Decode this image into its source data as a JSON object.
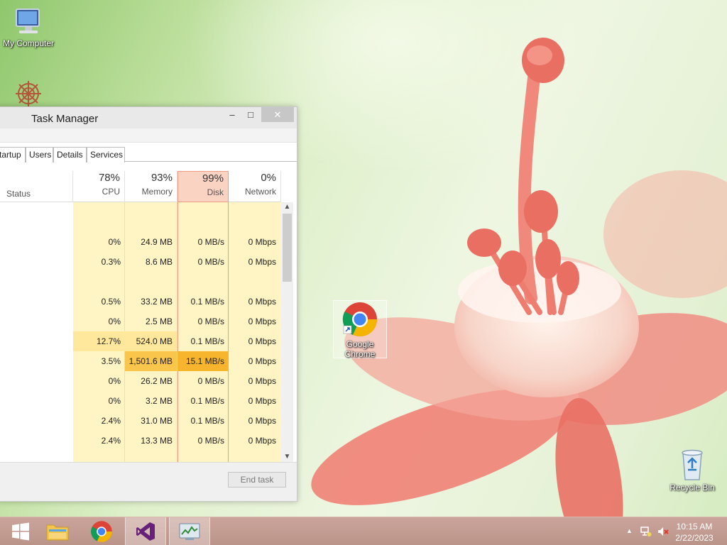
{
  "desktop": {
    "icons": [
      {
        "id": "my-computer",
        "label": "My Computer"
      },
      {
        "id": "google-chrome",
        "label": "Google Chrome"
      },
      {
        "id": "recycle-bin",
        "label": "Recycle Bin"
      }
    ]
  },
  "task_manager": {
    "title": "Task Manager",
    "window_buttons": {
      "minimize": "‒",
      "maximize": "□",
      "close": "✕"
    },
    "tabs": [
      "tartup",
      "Users",
      "Details",
      "Services"
    ],
    "columns": {
      "status": {
        "label": "Status"
      },
      "cpu": {
        "percent": "78%",
        "label": "CPU"
      },
      "memory": {
        "percent": "93%",
        "label": "Memory"
      },
      "disk": {
        "percent": "99%",
        "label": "Disk"
      },
      "network": {
        "percent": "0%",
        "label": "Network"
      }
    },
    "rows": [
      {
        "cpu": "",
        "memory": "",
        "disk": "",
        "network": ""
      },
      {
        "cpu": "0%",
        "memory": "24.9 MB",
        "disk": "0 MB/s",
        "network": "0 Mbps"
      },
      {
        "cpu": "0.3%",
        "memory": "8.6 MB",
        "disk": "0 MB/s",
        "network": "0 Mbps"
      },
      {
        "cpu": "",
        "memory": "",
        "disk": "",
        "network": ""
      },
      {
        "cpu": "0.5%",
        "memory": "33.2 MB",
        "disk": "0.1 MB/s",
        "network": "0 Mbps"
      },
      {
        "cpu": "0%",
        "memory": "2.5 MB",
        "disk": "0 MB/s",
        "network": "0 Mbps"
      },
      {
        "cpu": "12.7%",
        "memory": "524.0 MB",
        "disk": "0.1 MB/s",
        "network": "0 Mbps"
      },
      {
        "cpu": "3.5%",
        "memory": "1,501.6 MB",
        "disk": "15.1 MB/s",
        "network": "0 Mbps"
      },
      {
        "cpu": "0%",
        "memory": "26.2 MB",
        "disk": "0 MB/s",
        "network": "0 Mbps"
      },
      {
        "cpu": "0%",
        "memory": "3.2 MB",
        "disk": "0.1 MB/s",
        "network": "0 Mbps"
      },
      {
        "cpu": "2.4%",
        "memory": "31.0 MB",
        "disk": "0.1 MB/s",
        "network": "0 Mbps"
      },
      {
        "cpu": "2.4%",
        "memory": "13.3 MB",
        "disk": "0 MB/s",
        "network": "0 Mbps"
      }
    ],
    "end_task_label": "End task"
  },
  "taskbar": {
    "apps": [
      "start",
      "file-explorer",
      "chrome",
      "visual-studio",
      "task-manager"
    ],
    "clock_time": "10:15 AM",
    "clock_date": "2/22/2023"
  },
  "colors": {
    "heat_light": "#fff4c4",
    "heat_medium": "#ffe79b",
    "heat_strong": "#f9c54a",
    "heat_hot": "#f7b52d",
    "disk_highlight": "#fbd3c3"
  }
}
